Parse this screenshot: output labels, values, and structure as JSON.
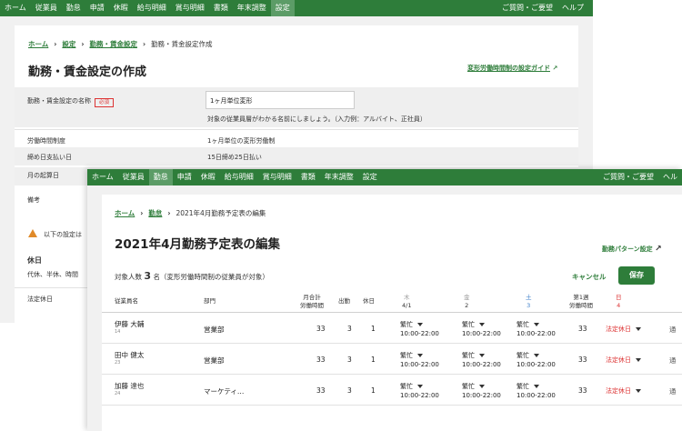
{
  "back": {
    "nav": [
      "ホーム",
      "従業員",
      "勤怠",
      "申請",
      "休暇",
      "給与明細",
      "賞与明細",
      "書類",
      "年末調整",
      "設定"
    ],
    "nav_active": 9,
    "nav_right": [
      "ご質問・ご要望",
      "ヘルプ"
    ],
    "breadcrumb": {
      "home": "ホーム",
      "settings": "設定",
      "section": "勤務・賃金設定",
      "current": "勤務・賃金設定作成"
    },
    "title": "勤務・賃金設定の作成",
    "guide_link": "変形労働時間制の設定ガイド",
    "fields": {
      "name_label": "勤務・賃金設定の名称",
      "required_badge": "必須",
      "name_value": "1ヶ月単位変形",
      "name_hint": "対象の従業員層がわかる名前にしましょう。（入力例：アルバイト、正社員）",
      "system_label": "労働時間制度",
      "system_value": "1ヶ月単位の変形労働制",
      "closing_label": "締め日支払い日",
      "closing_value": "15日締め25日払い",
      "start_label": "月の起算日",
      "notes_label": "備考",
      "warning_text": "以下の設定は",
      "holiday_heading": "休日",
      "holiday_text": "代休、半休、時間",
      "legal_holiday_label": "法定休日"
    }
  },
  "front": {
    "nav": [
      "ホーム",
      "従業員",
      "勤怠",
      "申請",
      "休暇",
      "給与明細",
      "賞与明細",
      "書類",
      "年末調整",
      "設定"
    ],
    "nav_active": 2,
    "nav_right": [
      "ご質問・ご要望",
      "ヘル"
    ],
    "breadcrumb": {
      "home": "ホーム",
      "attendance": "勤怠",
      "current": "2021年4月勤務予定表の編集"
    },
    "title": "2021年4月勤務予定表の編集",
    "pattern_link": "勤務パターン設定",
    "count_prefix": "対象人数",
    "count_value": "3",
    "count_suffix": "名（変形労働時間制の従業員が対象）",
    "cancel_label": "キャンセル",
    "save_label": "保存",
    "headers": {
      "name": "従業員名",
      "dept": "部門",
      "monthly_total": "月合計",
      "monthly_total2": "労働時間",
      "workdays": "出勤",
      "holidays": "休日",
      "d1": {
        "dow": "木",
        "date": "4/1"
      },
      "d2": {
        "dow": "金",
        "date": "2"
      },
      "d3": {
        "dow": "土",
        "date": "3"
      },
      "week1": "第1週",
      "week1b": "労働時間",
      "d4": {
        "dow": "日",
        "date": "4"
      }
    },
    "rows": [
      {
        "name": "伊藤 大輔",
        "id": "14",
        "dept": "営業部",
        "total": "33",
        "work": "3",
        "off": "1",
        "shift": "繁忙",
        "time": "10:00-22:00",
        "week": "33",
        "sunday": "法定休日",
        "extra": "通"
      },
      {
        "name": "田中 健太",
        "id": "23",
        "dept": "営業部",
        "total": "33",
        "work": "3",
        "off": "1",
        "shift": "繁忙",
        "time": "10:00-22:00",
        "week": "33",
        "sunday": "法定休日",
        "extra": "通"
      },
      {
        "name": "加藤 達也",
        "id": "24",
        "dept": "マーケティ…",
        "total": "33",
        "work": "3",
        "off": "1",
        "shift": "繁忙",
        "time": "10:00-22:00",
        "week": "33",
        "sunday": "法定休日",
        "extra": "通"
      }
    ],
    "colors": {
      "green": "#2e7d3a",
      "saturday": "#3b7ec9",
      "sunday": "#d33"
    }
  }
}
